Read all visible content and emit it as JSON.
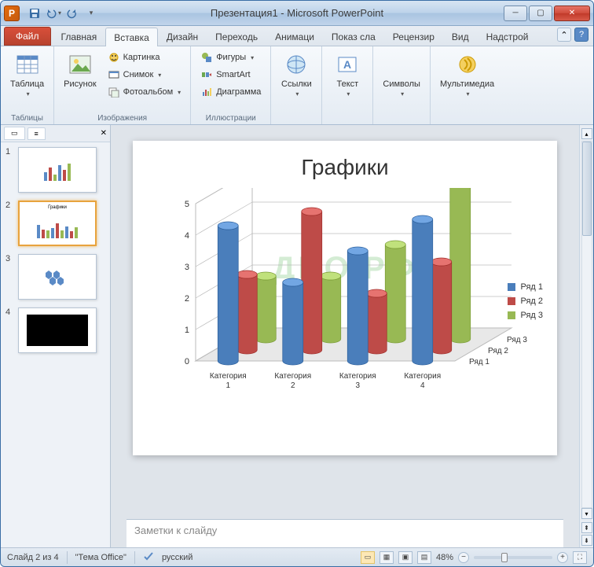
{
  "window": {
    "app_letter": "P",
    "title": "Презентация1  -  Microsoft PowerPoint"
  },
  "qat": {
    "save_icon": "save-icon",
    "undo_icon": "undo-icon",
    "redo_icon": "redo-icon"
  },
  "tabs": {
    "file": "Файл",
    "items": [
      "Главная",
      "Вставка",
      "Дизайн",
      "Переходь",
      "Анимаци",
      "Показ сла",
      "Рецензир",
      "Вид",
      "Надстрой"
    ],
    "active_index": 1
  },
  "ribbon": {
    "groups": {
      "tables": {
        "label": "Таблицы",
        "table_btn": "Таблица"
      },
      "images": {
        "label": "Изображения",
        "picture": "Рисунок",
        "clipart": "Картинка",
        "screenshot": "Снимок",
        "photoalbum": "Фотоальбом"
      },
      "illustrations": {
        "label": "Иллюстрации",
        "shapes": "Фигуры",
        "smartart": "SmartArt",
        "chart": "Диаграмма"
      },
      "links": {
        "label": "",
        "links": "Ссылки"
      },
      "text": {
        "label": "",
        "text": "Текст"
      },
      "symbols": {
        "label": "",
        "symbols": "Символы"
      },
      "media": {
        "label": "",
        "media": "Мультимедиа"
      }
    }
  },
  "thumbnails": {
    "items": [
      {
        "num": "1"
      },
      {
        "num": "2"
      },
      {
        "num": "3"
      },
      {
        "num": "4"
      }
    ],
    "active_index": 1
  },
  "slide": {
    "title": "Графики",
    "watermark": "ДЦО.РФ",
    "notes_placeholder": "Заметки к слайду"
  },
  "chart_data": {
    "type": "bar",
    "title": "Графики",
    "categories": [
      "Категория 1",
      "Категория 2",
      "Категория 3",
      "Категория 4"
    ],
    "series": [
      {
        "name": "Ряд 1",
        "color": "#4a7ebb",
        "values": [
          4.3,
          2.5,
          3.5,
          4.5
        ]
      },
      {
        "name": "Ряд 2",
        "color": "#be4b48",
        "values": [
          2.4,
          4.4,
          1.8,
          2.8
        ]
      },
      {
        "name": "Ряд 3",
        "color": "#98b954",
        "values": [
          2.0,
          2.0,
          3.0,
          5.0
        ]
      }
    ],
    "ylim": [
      0,
      5
    ],
    "yticks": [
      0,
      1,
      2,
      3,
      4,
      5
    ],
    "depth_labels": [
      "Ряд 1",
      "Ряд 2",
      "Ряд 3"
    ],
    "legend_position": "right"
  },
  "statusbar": {
    "slide_info": "Слайд 2 из 4",
    "theme": "\"Тема Office\"",
    "language": "русский",
    "zoom": "48%"
  }
}
